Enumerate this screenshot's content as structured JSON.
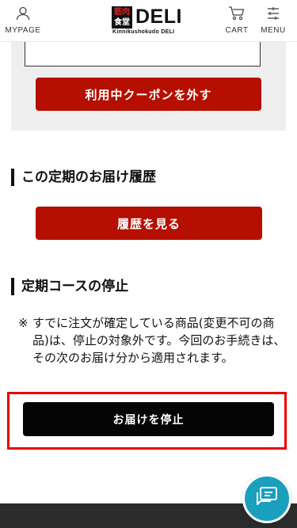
{
  "header": {
    "mypage_label": "MYPAGE",
    "cart_label": "CART",
    "menu_label": "MENU",
    "logo": {
      "box_top": "筋肉",
      "box_bottom": "食堂",
      "main": "DELI",
      "sub": "Kinnikushokudo DELI"
    }
  },
  "coupon": {
    "remove_button_label": "利用中クーポンを外す"
  },
  "history_section": {
    "title": "この定期のお届け履歴",
    "button_label": "履歴を見る"
  },
  "stop_section": {
    "title": "定期コースの停止",
    "note_mark": "※",
    "note_text": "すでに注文が確定している商品(変更不可の商品)は、停止の対象外です。今回のお手続きは、その次のお届け分から適用されます。",
    "stop_button_label": "お届けを停止"
  },
  "colors": {
    "accent_red": "#b40f00",
    "highlight_red": "#e80000",
    "chat_blue": "#1a9fbd",
    "stop_button": "#050505"
  },
  "icons": {
    "mypage": "user-icon",
    "cart": "cart-icon",
    "menu": "menu-icon",
    "chat": "chat-icon"
  }
}
